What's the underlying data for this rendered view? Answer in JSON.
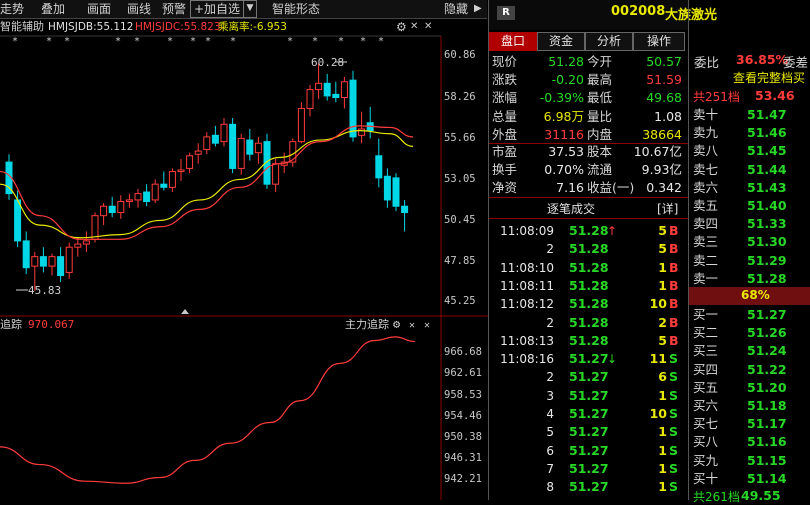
{
  "toolbar": {
    "trend": "走势",
    "add": "叠加",
    "draw": "画面",
    "line_draw": "画线",
    "alert": "预警",
    "add_fav": "+加自选",
    "smart_shape": "智能形态",
    "hide": "隐藏"
  },
  "indicator": {
    "name": "智能辅助",
    "ma1": "HMJSJDB:55.112",
    "ma2": "HMJSJDC:55.823",
    "dev": "乘离率:-6.953"
  },
  "price_axis": [
    "60.86",
    "58.26",
    "55.66",
    "53.05",
    "50.45",
    "47.85",
    "45.25"
  ],
  "price_labels": {
    "high": "60.28",
    "low": "45.83"
  },
  "lower_axis": [
    "966.68",
    "962.61",
    "958.53",
    "954.46",
    "950.38",
    "946.31",
    "942.21"
  ],
  "lower_indicator": {
    "left_name": "追踪",
    "left_value": "970.067",
    "right_name": "主力追踪"
  },
  "header": {
    "badge": "R",
    "code": "002008",
    "name": "大族激光"
  },
  "tabs": [
    "盘口",
    "资金",
    "分析",
    "操作"
  ],
  "quote": [
    {
      "l1": "现价",
      "v1": "51.28",
      "c1": "green",
      "l2": "今开",
      "v2": "50.57",
      "c2": "green"
    },
    {
      "l1": "涨跌",
      "v1": "-0.20",
      "c1": "green",
      "l2": "最高",
      "v2": "51.59",
      "c2": "red"
    },
    {
      "l1": "涨幅",
      "v1": "-0.39%",
      "c1": "green",
      "l2": "最低",
      "v2": "49.68",
      "c2": "green"
    },
    {
      "l1": "总量",
      "v1": "6.98万",
      "c1": "yellow",
      "l2": "量比",
      "v2": "1.08",
      "c2": "white"
    },
    {
      "l1": "外盘",
      "v1": "31116",
      "c1": "red",
      "l2": "内盘",
      "v2": "38664",
      "c2": "yellow"
    }
  ],
  "fundamentals": [
    {
      "l1": "市盈",
      "v1": "37.53",
      "l2": "股本",
      "v2": "10.67亿"
    },
    {
      "l1": "换手",
      "v1": "0.70%",
      "l2": "流通",
      "v2": "9.93亿"
    },
    {
      "l1": "净资",
      "v1": "7.16",
      "l2": "收益(一)",
      "v2": "0.342"
    }
  ],
  "trades_title": "逐笔成交",
  "trades_detail": "[详]",
  "trades": [
    {
      "time": "11:08:09",
      "price": "51.28",
      "arrow": "↑",
      "vol": "5",
      "side": "B"
    },
    {
      "time": "2",
      "price": "51.28",
      "arrow": "",
      "vol": "5",
      "side": "B"
    },
    {
      "time": "11:08:10",
      "price": "51.28",
      "arrow": "",
      "vol": "1",
      "side": "B"
    },
    {
      "time": "11:08:11",
      "price": "51.28",
      "arrow": "",
      "vol": "1",
      "side": "B"
    },
    {
      "time": "11:08:12",
      "price": "51.28",
      "arrow": "",
      "vol": "10",
      "side": "B"
    },
    {
      "time": "2",
      "price": "51.28",
      "arrow": "",
      "vol": "2",
      "side": "B"
    },
    {
      "time": "11:08:13",
      "price": "51.28",
      "arrow": "",
      "vol": "5",
      "side": "B"
    },
    {
      "time": "11:08:16",
      "price": "51.27",
      "arrow": "↓",
      "vol": "11",
      "side": "S"
    },
    {
      "time": "2",
      "price": "51.27",
      "arrow": "",
      "vol": "6",
      "side": "S"
    },
    {
      "time": "3",
      "price": "51.27",
      "arrow": "",
      "vol": "1",
      "side": "S"
    },
    {
      "time": "4",
      "price": "51.27",
      "arrow": "",
      "vol": "10",
      "side": "S"
    },
    {
      "time": "5",
      "price": "51.27",
      "arrow": "",
      "vol": "1",
      "side": "S"
    },
    {
      "time": "6",
      "price": "51.27",
      "arrow": "",
      "vol": "1",
      "side": "S"
    },
    {
      "time": "7",
      "price": "51.27",
      "arrow": "",
      "vol": "1",
      "side": "S"
    },
    {
      "time": "8",
      "price": "51.27",
      "arrow": "",
      "vol": "1",
      "side": "S"
    }
  ],
  "order_book": {
    "ratio_label": "委比",
    "ratio_value": "36.85%",
    "diff_label": "委差",
    "full_link": "查看完整档买",
    "sell_total_label": "共251档",
    "sell_total_value": "53.46",
    "sells": [
      {
        "label": "卖十",
        "price": "51.47"
      },
      {
        "label": "卖九",
        "price": "51.46"
      },
      {
        "label": "卖八",
        "price": "51.45"
      },
      {
        "label": "卖七",
        "price": "51.44"
      },
      {
        "label": "卖六",
        "price": "51.43"
      },
      {
        "label": "卖五",
        "price": "51.40"
      },
      {
        "label": "卖四",
        "price": "51.33"
      },
      {
        "label": "卖三",
        "price": "51.30"
      },
      {
        "label": "卖二",
        "price": "51.29"
      },
      {
        "label": "卖一",
        "price": "51.28"
      }
    ],
    "mid_pct": "68%",
    "buys": [
      {
        "label": "买一",
        "price": "51.27"
      },
      {
        "label": "买二",
        "price": "51.26"
      },
      {
        "label": "买三",
        "price": "51.24"
      },
      {
        "label": "买四",
        "price": "51.22"
      },
      {
        "label": "买五",
        "price": "51.20"
      },
      {
        "label": "买六",
        "price": "51.18"
      },
      {
        "label": "买七",
        "price": "51.17"
      },
      {
        "label": "买八",
        "price": "51.16"
      },
      {
        "label": "买九",
        "price": "51.15"
      },
      {
        "label": "买十",
        "price": "51.14"
      }
    ],
    "buy_total_label": "共261档",
    "buy_total_value": "49.55"
  },
  "colors": {
    "up": "#ff3c3c",
    "down": "#27d827",
    "bg": "#000000",
    "accent": "#b00000"
  }
}
